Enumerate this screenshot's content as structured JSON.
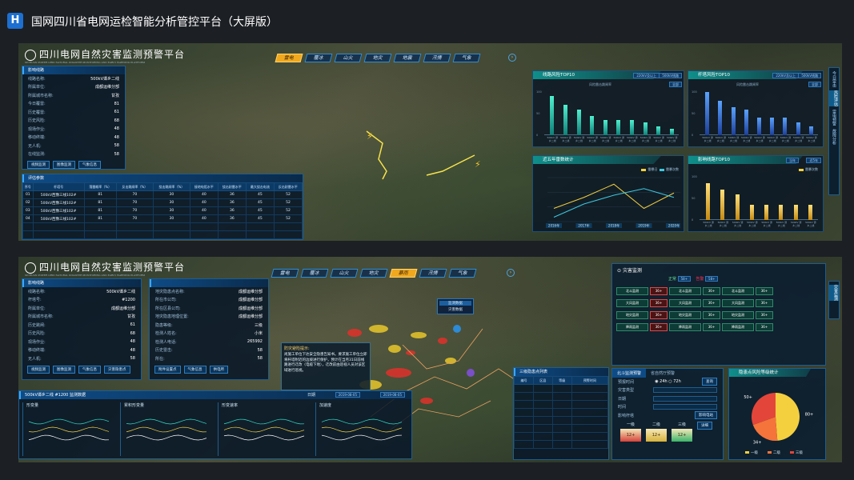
{
  "header": {
    "logo_letter": "H",
    "title": "国网四川省电网运检智能分析管控平台（大屏版）"
  },
  "brand": {
    "title": "四川电网自然灾害监测预警平台",
    "subtitle": "SICHUAN POWER GRID NATURAL DISASTER MONITORING AND EARLY WARNING PLATFORM"
  },
  "tabs": {
    "top": [
      "雷电",
      "覆冰",
      "山火",
      "地灾",
      "地震",
      "汛情",
      "气象"
    ],
    "top_active": 0,
    "bottom": [
      "雷电",
      "覆冰",
      "山火",
      "地灾",
      "暴雨",
      "汛情",
      "气象"
    ],
    "bottom_active": 4
  },
  "top_influence": {
    "title": "影响线路",
    "rows": [
      [
        "线路名称:",
        "500kV谭乡二线"
      ],
      [
        "所属单位:",
        "成都运维分部"
      ],
      [
        "所属城市名称:",
        "甘孜"
      ],
      [
        "今日覆雷:",
        "81"
      ],
      [
        "历史覆雷:",
        "61"
      ],
      [
        "历史风险:",
        "68"
      ],
      [
        "现场作业:",
        "48"
      ],
      [
        "移动终端:",
        "48"
      ],
      [
        "无人机:",
        "58"
      ],
      [
        "在线监测:",
        "58"
      ]
    ],
    "buttons": [
      "视频监测",
      "图像监测",
      "气象信息"
    ]
  },
  "eval": {
    "title": "评估参数",
    "headers": [
      "序号",
      "杆塔号",
      "落雷概率（%）",
      "反击跳闸率（%）",
      "绕击跳闸率（%）",
      "接地电阻水平",
      "绕击耐雷水平",
      "最大绕击电流",
      "反击耐雷水平"
    ],
    "rows": [
      [
        "01",
        "500kV西豫三线102#",
        "81",
        "70",
        "30",
        "40",
        "36",
        "45",
        "52"
      ],
      [
        "02",
        "500kV西豫三线102#",
        "81",
        "70",
        "30",
        "40",
        "36",
        "45",
        "52"
      ],
      [
        "03",
        "500kV西豫三线102#",
        "81",
        "70",
        "30",
        "40",
        "36",
        "45",
        "52"
      ],
      [
        "04",
        "500kV西豫三线102#",
        "81",
        "70",
        "30",
        "40",
        "36",
        "45",
        "52"
      ]
    ]
  },
  "c1": {
    "title": "线路风险TOP10",
    "pills": [
      "220kV及以上",
      "500kV线路"
    ],
    "tag": "全部",
    "legend": "风险雷击跳闸率",
    "categories": [
      "500kV\n谭乡二线",
      "500kV\n谭乡二线",
      "500kV\n谭乡二线",
      "500kV\n谭乡二线",
      "500kV\n谭乡二线",
      "500kV\n谭乡二线",
      "500kV\n谭乡二线",
      "500kV\n谭乡二线",
      "500kV\n谭乡二线",
      "500kV\n谭乡二线"
    ],
    "values": [
      90,
      70,
      60,
      45,
      35,
      35,
      35,
      30,
      20,
      15
    ]
  },
  "c2": {
    "title": "杆塔风险TOP10",
    "pills": [
      "220kV及以上",
      "500kV线路"
    ],
    "tag": "全部",
    "legend": "风险雷击跳闸率",
    "categories": [
      "500kV\n谭乡二线",
      "500kV\n谭乡二线",
      "500kV\n谭乡二线",
      "500kV\n谭乡二线",
      "500kV\n谭乡二线",
      "500kV\n谭乡二线",
      "500kV\n谭乡二线",
      "500kV\n谭乡二线",
      "500kV\n谭乡二线"
    ],
    "values": [
      100,
      80,
      65,
      60,
      40,
      40,
      40,
      30,
      20
    ]
  },
  "c3": {
    "title": "近五年雷数统计",
    "series": [
      {
        "name": "雷暴日",
        "values": [
          30,
          55,
          85,
          30,
          65
        ]
      },
      {
        "name": "雷暴次数",
        "values": [
          10,
          40,
          60,
          75,
          55
        ]
      }
    ],
    "years": [
      "2016年",
      "2017年",
      "2018年",
      "2019年",
      "2020年"
    ]
  },
  "c4": {
    "title": "影响线路TOP10",
    "pills": [
      "当年",
      "近5年"
    ],
    "legend": "雷暴次数",
    "categories": [
      "500kV\n谭乡二线",
      "500kV\n谭乡二线",
      "500kV\n谭乡二线",
      "500kV\n谭乡二线",
      "500kV\n谭乡二线",
      "500kV\n谭乡二线",
      "500kV\n谭乡二线",
      "500kV\n谭乡二线"
    ],
    "values": [
      85,
      70,
      60,
      35,
      35,
      35,
      35,
      35
    ]
  },
  "right_sidebar": {
    "items": [
      "今日雷击",
      "风险评估",
      "雷电预警",
      "故障分析"
    ],
    "active": 1
  },
  "b_line": {
    "title": "影响线路",
    "rows": [
      [
        "线路名称:",
        "500kV谭乡二线"
      ],
      [
        "杆塔号:",
        "#1200"
      ],
      [
        "所属单位:",
        "成都运维分部"
      ],
      [
        "所属城市名称:",
        "甘孜"
      ],
      [
        "历史跳闸:",
        "61"
      ],
      [
        "历史风险:",
        "68"
      ],
      [
        "现场作业:",
        "48"
      ],
      [
        "移动终端:",
        "48"
      ],
      [
        "无人机:",
        "58"
      ]
    ],
    "buttons": [
      "视频监测",
      "图像监测",
      "气象信息",
      "灾害隐患点"
    ]
  },
  "b_hazard": {
    "rows": [
      [
        "地灾隐患点名称:",
        "成都运维分部"
      ],
      [
        "所在市公司:",
        "成都运维分部"
      ],
      [
        "所在区县公司:",
        "成都运维分部"
      ],
      [
        "地灾隐患地理位置:",
        "成都运维分部"
      ],
      [
        "隐患等级:",
        "三级"
      ],
      [
        "检测人姓名:",
        "小米"
      ],
      [
        "检测人电话:",
        "265992"
      ],
      [
        "历史雷击:",
        "58"
      ],
      [
        "所在:",
        "58"
      ]
    ],
    "buttons": [
      "附件设置点",
      "气象信息",
      "供电所"
    ]
  },
  "b_alert": {
    "title": "防灾避险提示:",
    "text": "尚施工单位下达安全隐患告知书。要求施工单位立即将杆塔附近的边坡进行保护，预计在当月31日前线路进行迁改（电缆下地），迁改前由巡视人员对该区域进行巡视。"
  },
  "b_pop": {
    "items": [
      "监测数据",
      "灾害数据"
    ]
  },
  "b_list": {
    "title": "三级隐患点列表",
    "headers": [
      "编号",
      "区县",
      "等级",
      "预警时间"
    ]
  },
  "b_monitor": {
    "title": "500kV谭乡二线 #1200 监测数据",
    "tag": "日期",
    "date_from": "2019-08-05",
    "date_to": "2019-08-05",
    "tabs": [
      "形变量",
      "累积形变量",
      "形变速率",
      "加速度"
    ]
  },
  "disaster": {
    "title": "灾害监测",
    "normal_label": "正常",
    "normal": "58+",
    "warn_label": "告警",
    "warn": "58+",
    "items": [
      "北斗监测",
      "大风监测",
      "地灾监测",
      "降雨监测"
    ],
    "val": "36+"
  },
  "beidou": {
    "title": "北斗监测预警",
    "tab2": "省自然厅预警",
    "period_label": "预报时间",
    "periods": [
      "24h",
      "72h"
    ],
    "query": "查询",
    "fields": [
      "灾害类型",
      "日期",
      "时间"
    ],
    "impact": "影响杆塔",
    "impact_tab": "影响电站",
    "levels": [
      "一级",
      "二级",
      "三级"
    ],
    "level_val": "12+",
    "more": "详细"
  },
  "pie": {
    "title": "隐患点风险等级统计",
    "labels": [
      "80+",
      "34+",
      "50+"
    ],
    "legend": [
      "一级",
      "二级",
      "三级"
    ],
    "values": [
      80,
      34,
      50
    ],
    "colors": [
      "#f4d03f",
      "#f4743b",
      "#e4453a"
    ]
  },
  "bside": {
    "item": "灾害监测"
  }
}
